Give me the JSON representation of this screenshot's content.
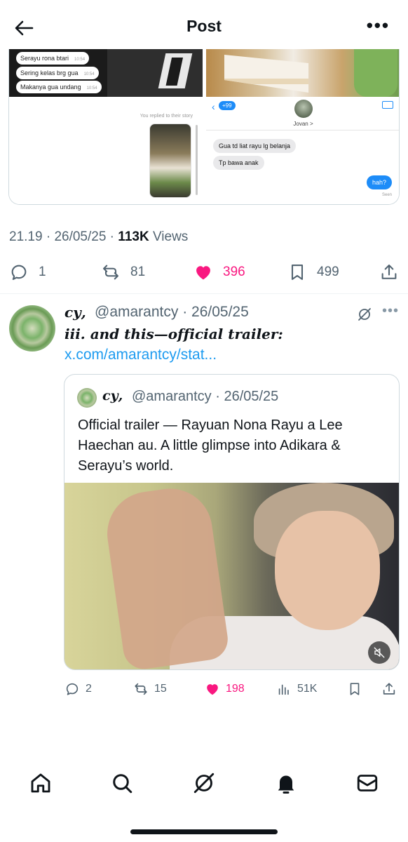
{
  "header": {
    "title": "Post",
    "back_icon": "arrow-left-icon",
    "more_icon": "more-horizontal-icon"
  },
  "media": {
    "left_chat": [
      {
        "text": "Serayu rona btari",
        "time": "10:54"
      },
      {
        "text": "Sering kelas brg gua",
        "time": "10:54"
      },
      {
        "text": "Makanya gua undang",
        "time": "10:54"
      }
    ],
    "replied_note": "You replied to their story",
    "right_chat": {
      "back_count": "+99",
      "contact_name": "Jovan >",
      "incoming": [
        "Gua td liat rayu lg belanja",
        "Tp bawa anak"
      ],
      "outgoing": "hah?",
      "receipt": "Seen"
    }
  },
  "post": {
    "time": "21.19",
    "date": "26/05/25",
    "views_count": "113K",
    "views_label": "Views",
    "replies": "1",
    "reposts": "81",
    "likes": "396",
    "bookmarks": "499",
    "like_color": "#f91880"
  },
  "reply": {
    "display_name": "𝒄𝒚,",
    "handle": "@amarantcy",
    "date": "26/05/25",
    "text": "𝒊𝒊𝒊. 𝒂𝒏𝒅 𝒕𝒉𝒊𝒔—𝒐𝒇𝒇𝒊𝒄𝒊𝒂𝒍 𝒕𝒓𝒂𝒊𝒍𝒆𝒓:",
    "link": "x.com/amarantcy/stat...",
    "quote": {
      "display_name": "𝒄𝒚,",
      "handle": "@amarantcy",
      "date": "26/05/25",
      "text": "Official trailer — Rayuan Nona Rayu a Lee Haechan au. A little glimpse into Adikara & Serayu’s world."
    },
    "stats": {
      "replies": "2",
      "reposts": "15",
      "likes": "198",
      "views": "51K"
    }
  },
  "nav": [
    "home-icon",
    "search-icon",
    "grok-icon",
    "notifications-icon",
    "messages-icon"
  ]
}
